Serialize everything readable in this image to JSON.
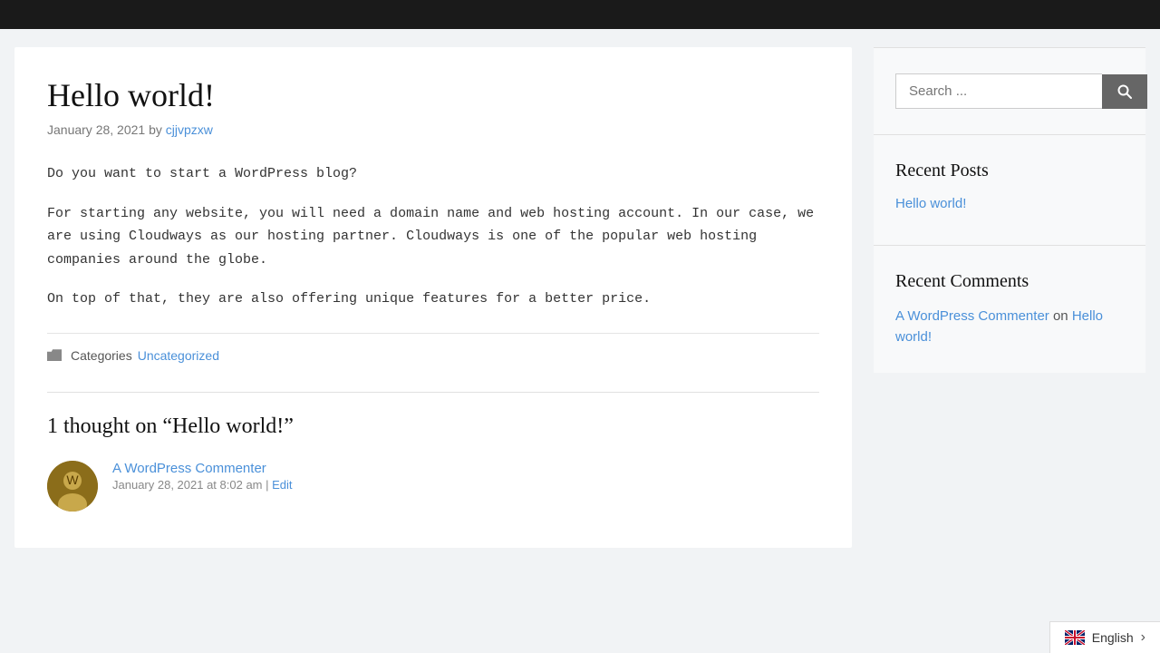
{
  "topbar": {},
  "post": {
    "title": "Hello world!",
    "meta": {
      "date": "January 28, 2021",
      "by": "by",
      "author": "cjjvpzxw",
      "author_href": "#"
    },
    "paragraphs": [
      "Do you want to start a WordPress blog?",
      "For starting any website, you will need a domain name and web hosting account. In our case, we are using Cloudways as our hosting partner. Cloudways is one of the popular web hosting companies around the globe.",
      "On top of that, they are also offering unique features for a better price."
    ],
    "footer": {
      "category_label": "Uncategorized",
      "category_href": "#"
    }
  },
  "comments": {
    "heading": "1 thought on “Hello world!”",
    "items": [
      {
        "author": "A WordPress Commenter",
        "author_href": "#",
        "date": "January 28, 2021 at 8:02 am",
        "date_href": "#",
        "edit_label": "Edit",
        "edit_href": "#"
      }
    ]
  },
  "sidebar": {
    "search": {
      "placeholder": "Search ...",
      "button_label": "Search"
    },
    "recent_posts": {
      "title": "Recent Posts",
      "items": [
        {
          "label": "Hello world!",
          "href": "#"
        }
      ]
    },
    "recent_comments": {
      "title": "Recent Comments",
      "commenter": "A WordPress Commenter",
      "commenter_href": "#",
      "on_text": "on",
      "post_link": "Hello world!",
      "post_href": "#"
    }
  },
  "language_bar": {
    "language": "English",
    "chevron": "›"
  }
}
